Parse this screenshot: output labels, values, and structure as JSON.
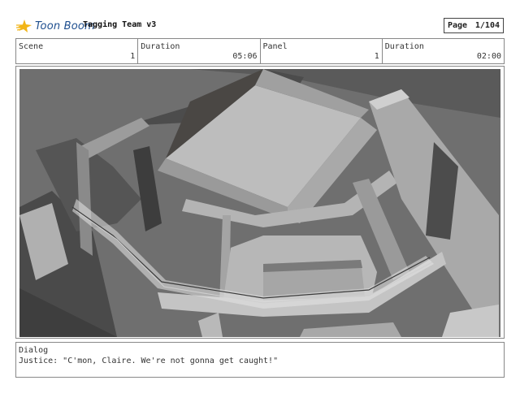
{
  "header": {
    "brand": "Toon Boom",
    "logo_icon": "toon-boom-star-icon",
    "title": "Tagging Team v3",
    "page_label": "Page",
    "page_value": "1/104"
  },
  "meta": {
    "scene_label": "Scene",
    "scene_value": "1",
    "scene_duration_label": "Duration",
    "scene_duration_value": "05:06",
    "panel_label": "Panel",
    "panel_value": "1",
    "panel_duration_label": "Duration",
    "panel_duration_value": "02:00"
  },
  "dialog": {
    "label": "Dialog",
    "text": "Justice: \"C'mon, Claire. We're not gonna get caught!\""
  },
  "colors": {
    "logo_blue": "#1f4f8f",
    "logo_yellow": "#f2b517"
  }
}
